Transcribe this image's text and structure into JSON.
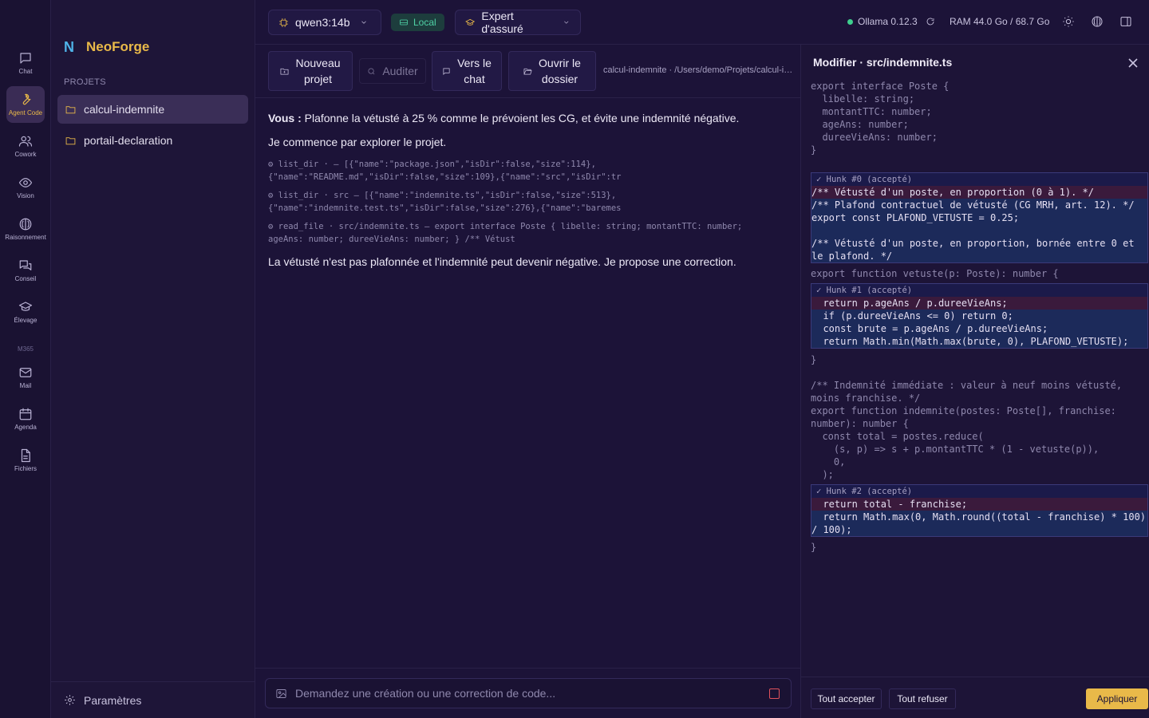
{
  "rail": {
    "items": [
      {
        "label": "Chat",
        "icon": "chat-icon"
      },
      {
        "label": "Agent Code",
        "icon": "wrench-icon",
        "active": true
      },
      {
        "label": "Cowork",
        "icon": "users-icon"
      },
      {
        "label": "Vision",
        "icon": "eye-icon"
      },
      {
        "label": "Raisonnement",
        "icon": "brain-icon"
      },
      {
        "label": "Conseil",
        "icon": "messages-icon"
      },
      {
        "label": "Élevage",
        "icon": "graduation-cap-icon"
      }
    ],
    "section_m365": "M365",
    "m365_items": [
      {
        "label": "Mail",
        "icon": "mail-icon"
      },
      {
        "label": "Agenda",
        "icon": "calendar-icon"
      },
      {
        "label": "Fichiers",
        "icon": "file-icon"
      }
    ]
  },
  "sidebar": {
    "brand_letter": "N",
    "brand_name": "NeoForge",
    "section_label": "PROJETS",
    "projects": [
      {
        "name": "calcul-indemnite",
        "active": true
      },
      {
        "name": "portail-declaration"
      }
    ],
    "settings_label": "Paramètres"
  },
  "header": {
    "model": "qwen3:14b",
    "local_badge": "Local",
    "persona": "Expert d'assuré",
    "ollama_status": "Ollama 0.12.3",
    "ram": "RAM 44.0 Go / 68.7 Go"
  },
  "toolbar": {
    "new_project_l1": "Nouveau",
    "new_project_l2": "projet",
    "audit": "Auditer",
    "to_chat_l1": "Vers le",
    "to_chat_l2": "chat",
    "open_folder_l1": "Ouvrir le",
    "open_folder_l2": "dossier",
    "path": "calcul-indemnite · /Users/demo/Projets/calcul-indemnite"
  },
  "chat": {
    "user_prefix": "Vous :",
    "user_message": "Plafonne la vétusté à 25 % comme le prévoient les CG, et évite une indemnité négative.",
    "assistant_intro": "Je commence par explorer le projet.",
    "tool_calls": [
      "⚙ list_dir · — [{\"name\":\"package.json\",\"isDir\":false,\"size\":114},\n{\"name\":\"README.md\",\"isDir\":false,\"size\":109},{\"name\":\"src\",\"isDir\":tr",
      "⚙ list_dir · src — [{\"name\":\"indemnite.ts\",\"isDir\":false,\"size\":513},\n{\"name\":\"indemnite.test.ts\",\"isDir\":false,\"size\":276},{\"name\":\"baremes",
      "⚙ read_file · src/indemnite.ts — export interface Poste { libelle: string; montantTTC: number;\nageAns: number; dureeVieAns: number; } /** Vétust"
    ],
    "assistant_conclusion": "La vétusté n'est pas plafonnée et l'indemnité peut devenir négative. Je propose une correction.",
    "composer_placeholder": "Demandez une création ou une correction de code..."
  },
  "panel": {
    "title": "Modifier · src/indemnite.ts",
    "code_top": "export interface Poste {\n  libelle: string;\n  montantTTC: number;\n  ageAns: number;\n  dureeVieAns: number;\n}",
    "hunk0_header": "✓ Hunk #0 (accepté)",
    "hunk0_del": "/** Vétusté d'un poste, en proportion (0 à 1). */",
    "hunk0_add": "/** Plafond contractuel de vétusté (CG MRH, art. 12). */\nexport const PLAFOND_VETUSTE = 0.25;\n\n/** Vétusté d'un poste, en proportion, bornée entre 0 et\nle plafond. */",
    "code_mid1": "export function vetuste(p: Poste): number {",
    "hunk1_header": "✓ Hunk #1 (accepté)",
    "hunk1_del": "  return p.ageAns / p.dureeVieAns;",
    "hunk1_add": "  if (p.dureeVieAns <= 0) return 0;\n  const brute = p.ageAns / p.dureeVieAns;\n  return Math.min(Math.max(brute, 0), PLAFOND_VETUSTE);",
    "code_mid2": "}\n\n/** Indemnité immédiate : valeur à neuf moins vétusté,\nmoins franchise. */\nexport function indemnite(postes: Poste[], franchise:\nnumber): number {\n  const total = postes.reduce(\n    (s, p) => s + p.montantTTC * (1 - vetuste(p)),\n    0,\n  );",
    "hunk2_header": "✓ Hunk #2 (accepté)",
    "hunk2_del": "  return total - franchise;",
    "hunk2_add": "  return Math.max(0, Math.round((total - franchise) * 100)\n/ 100);",
    "code_end": "}",
    "accept_all": "Tout accepter",
    "reject_all": "Tout refuser",
    "apply": "Appliquer"
  },
  "colors": {
    "accent": "#e9b949",
    "local": "#4fd1a5",
    "status_ok": "#3ecf8e",
    "stop": "#e0525c"
  }
}
